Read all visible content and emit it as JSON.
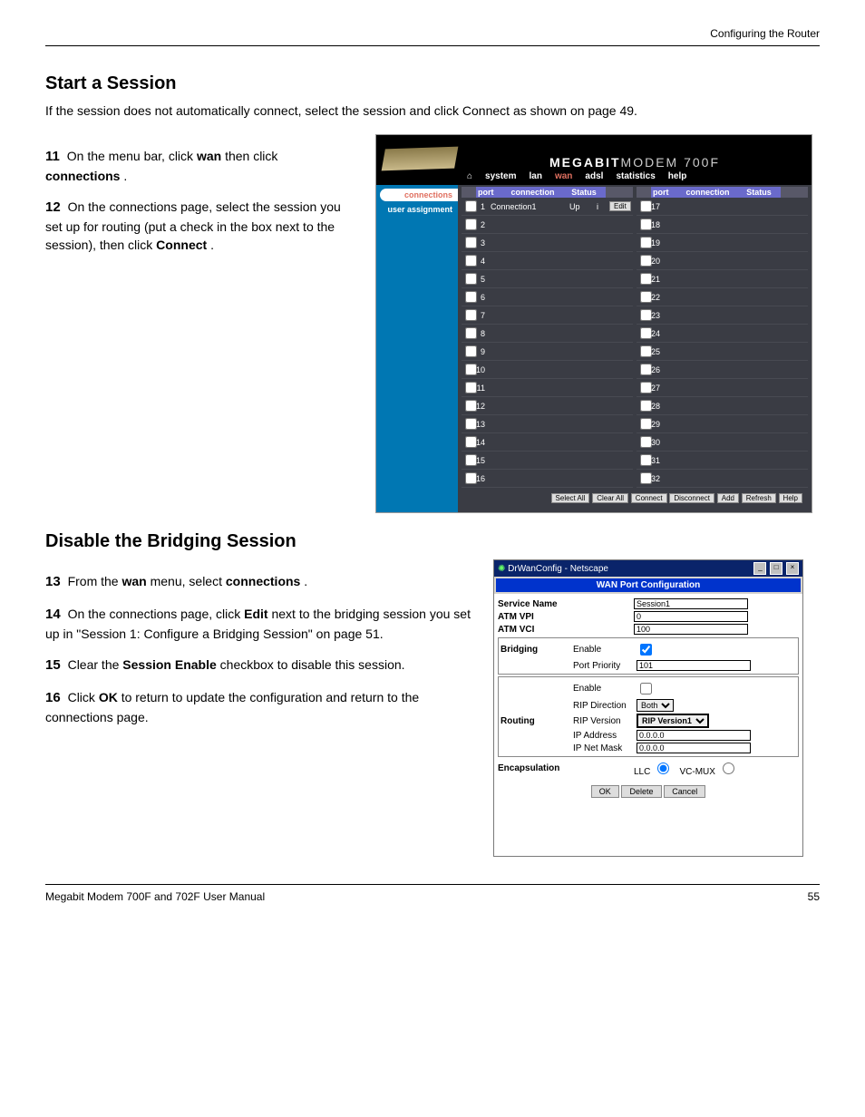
{
  "header": {
    "left": "",
    "right": "Configuring the Router"
  },
  "intro": {
    "heading": "Start a Session",
    "text": "If the session does not automatically connect, select the session and click Connect as shown on page 49."
  },
  "steps": {
    "s11": {
      "pre": "On the menu bar, click ",
      "b1": "wan",
      "mid": " then click ",
      "b2": "connections",
      "post": "."
    },
    "s12": {
      "pre": "On the connections page, select the session you set up for routing (put a check in the box next to the session), then click ",
      "b1": "Connect",
      "post": "."
    },
    "s13_heading": "Disable the Bridging Session",
    "s13": {
      "pre": "From the ",
      "b1": "wan",
      "mid": " menu, select ",
      "b2": "connections",
      "post": "."
    },
    "s14": {
      "pre": "On the connections page, click ",
      "b1": "Edit",
      "mid": " next to the bridging session you set up in \"Session 1: Configure a Bridging Session\" on page 51."
    },
    "s15": {
      "pre": "Clear the ",
      "b1": "Session Enable",
      "post": " checkbox to disable this session."
    },
    "s16": {
      "pre": "Click ",
      "b1": "OK",
      "post": " to return to update the configuration and return to the connections page."
    }
  },
  "fig1": {
    "brand_bold": "MEGABIT",
    "brand_thin": "MODEM 700F",
    "menu": [
      "system",
      "lan",
      "wan",
      "adsl",
      "statistics",
      "help"
    ],
    "menu_active": "wan",
    "side": {
      "active": "connections",
      "other": "user assignment"
    },
    "headers": [
      "port",
      "connection",
      "Status",
      ""
    ],
    "row1": {
      "port": "1",
      "conn": "Connection1",
      "status": "Up",
      "icon": "i",
      "edit": "Edit"
    },
    "ports_left": [
      "1",
      "2",
      "3",
      "4",
      "5",
      "6",
      "7",
      "8",
      "9",
      "10",
      "11",
      "12",
      "13",
      "14",
      "15",
      "16"
    ],
    "ports_right": [
      "17",
      "18",
      "19",
      "20",
      "21",
      "22",
      "23",
      "24",
      "25",
      "26",
      "27",
      "28",
      "29",
      "30",
      "31",
      "32"
    ],
    "buttons": [
      "Select All",
      "Clear All",
      "Connect",
      "Disconnect",
      "Add",
      "Refresh",
      "Help"
    ]
  },
  "fig2": {
    "titlebar": "DrWanConfig - Netscape",
    "title": "WAN Port Configuration",
    "fields": {
      "service_name": {
        "label": "Service Name",
        "value": "Session1"
      },
      "vpi": {
        "label": "ATM VPI",
        "value": "0"
      },
      "vci": {
        "label": "ATM VCI",
        "value": "100"
      },
      "bridging": {
        "label": "Bridging",
        "enable": "Enable",
        "priority_label": "Port Priority",
        "priority_value": "101"
      },
      "routing": {
        "label": "Routing",
        "enable": "Enable",
        "dir_label": "RIP Direction",
        "dir_value": "Both",
        "ver_label": "RIP Version",
        "ver_value": "RIP Version1",
        "ip_label": "IP Address",
        "ip_value": "0.0.0.0",
        "mask_label": "IP Net Mask",
        "mask_value": "0.0.0.0"
      },
      "encap": {
        "label": "Encapsulation",
        "opt1": "LLC",
        "opt2": "VC-MUX"
      }
    },
    "buttons": {
      "ok": "OK",
      "delete": "Delete",
      "cancel": "Cancel"
    }
  },
  "footer": {
    "left": "Megabit Modem 700F and 702F User Manual",
    "right": "55"
  }
}
